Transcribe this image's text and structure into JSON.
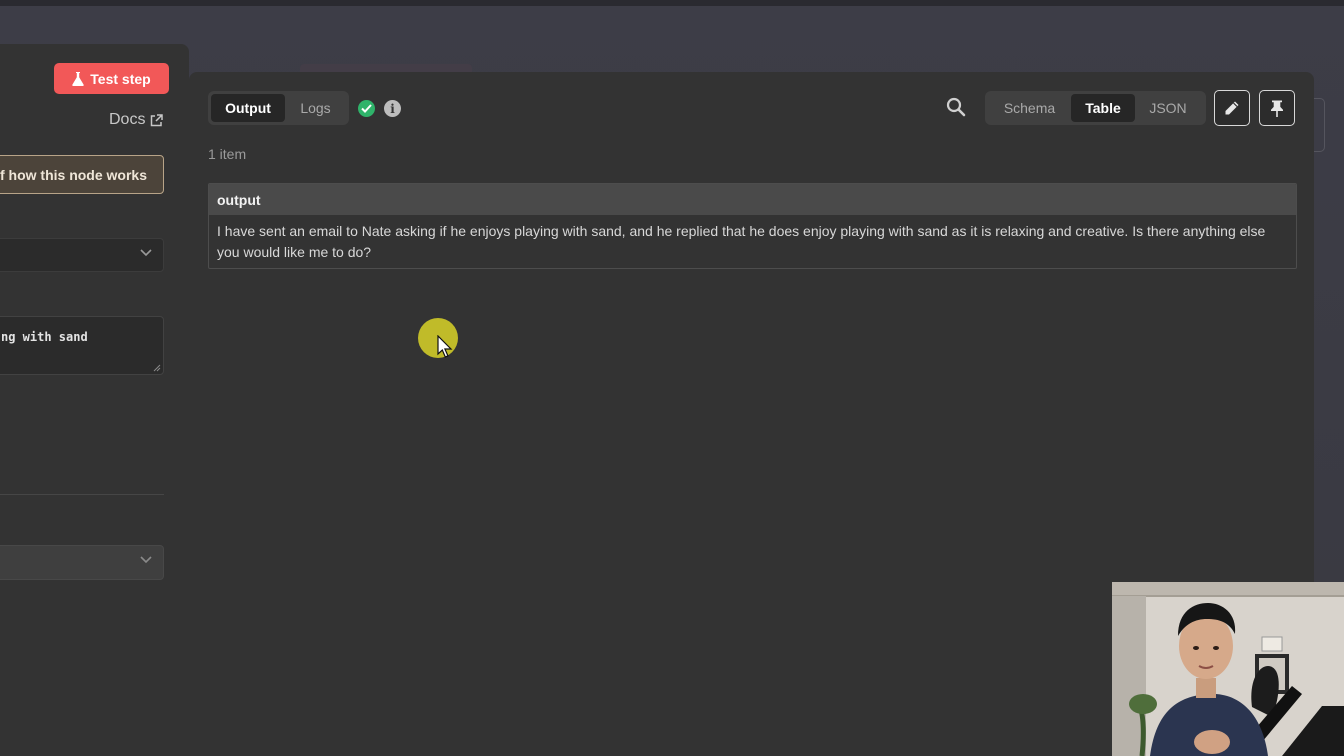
{
  "left_panel": {
    "test_button_label": "Test step",
    "docs_label": "Docs",
    "hint_text": "f how this node works",
    "prompt_value_visible": "ng with sand"
  },
  "output_panel": {
    "tabs": [
      {
        "label": "Output",
        "active": true
      },
      {
        "label": "Logs",
        "active": false
      }
    ],
    "status": "success",
    "info_glyph": "i",
    "view_modes": [
      {
        "label": "Schema",
        "active": false
      },
      {
        "label": "Table",
        "active": true
      },
      {
        "label": "JSON",
        "active": false
      }
    ],
    "item_count": "1 item",
    "table": {
      "header": "output",
      "rows": [
        "I have sent an email to Nate asking if he enjoys playing with sand, and he replied that he does enjoy playing with sand as it is relaxing and creative. Is there anything else you would like me to do?"
      ]
    }
  },
  "colors": {
    "accent_red": "#f25858",
    "success_green": "#2fb36a",
    "panel_bg": "#333333",
    "cursor_highlight": "#d4ce28"
  },
  "icons": [
    "flask-icon",
    "external-link-icon",
    "chevron-down-icon",
    "check-circle-icon",
    "info-icon",
    "search-icon",
    "pencil-icon",
    "pin-icon",
    "mouse-cursor-icon"
  ]
}
